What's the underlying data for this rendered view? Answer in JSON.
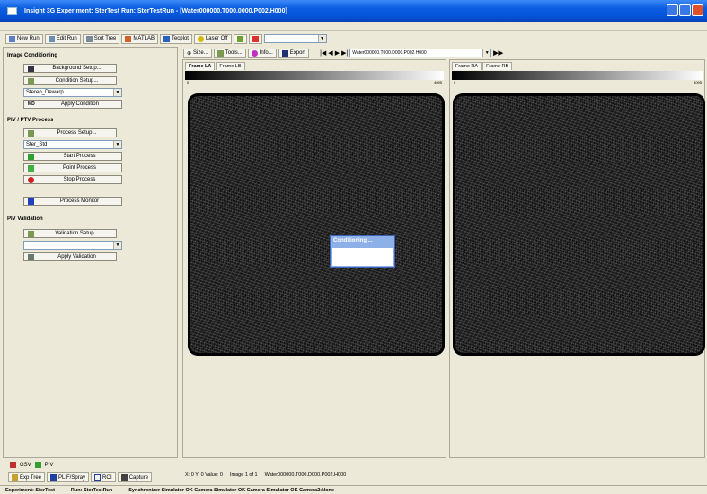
{
  "window": {
    "title": "Insight 3G  Experiment: SterTest    Run: SterTestRun  - [Water000000.T000.0000.P002.H000]"
  },
  "toolbar": [
    {
      "label": "New Run",
      "icon": "new-run-icon",
      "color": "#5a7fc8"
    },
    {
      "label": "Edit Run",
      "icon": "edit-run-icon",
      "color": "#6b8fb0"
    },
    {
      "label": "Sort Tree",
      "icon": "sort-tree-icon",
      "color": "#7a8a9a"
    },
    {
      "label": "MATLAB",
      "icon": "matlab-icon",
      "color": "#d0602a"
    },
    {
      "label": "Tecplot",
      "icon": "tecplot-icon",
      "color": "#2a60c0"
    },
    {
      "label": "Laser Off",
      "icon": "laser-icon",
      "color": "#d4b800"
    }
  ],
  "left": {
    "image_conditioning": {
      "title": "Image Conditioning",
      "background_setup": "Background Setup...",
      "condition_setup": "Condition Setup...",
      "condition_select": "Stereo_Dewarp",
      "apply_condition": "Apply Condition",
      "apply_icon_text": "MD"
    },
    "piv_process": {
      "title": "PIV / PTV Process",
      "process_setup": "Process Setup...",
      "process_select": "Ster_Std",
      "start": "Start Process",
      "point": "Point Process",
      "stop": "Stop Process",
      "monitor": "Process Monitor"
    },
    "validation": {
      "title": "PIV Validation",
      "setup": "Validation Setup...",
      "select": "",
      "apply": "Apply Validation"
    }
  },
  "bottom_tabs": {
    "row1": [
      "GSV",
      "PIV"
    ],
    "row2": [
      "Exp Tree",
      "PLIF/Spray",
      "ROI",
      "Capture"
    ]
  },
  "image_toolbar": {
    "size": "Size...",
    "tools": "Tools...",
    "info": "Info...",
    "export": "Export",
    "nav_first": "|◀",
    "nav_prev": "◀",
    "nav_next": "▶",
    "nav_last": "▶|",
    "file_select": "Water000000.T000.D000.P002.H000",
    "nav_end": "▶▶"
  },
  "frames": {
    "left_tabs": [
      "Frame LA",
      "Frame LB"
    ],
    "right_tabs": [
      "Frame RA",
      "Frame RB"
    ],
    "scale_min": "0",
    "scale_max": "4095"
  },
  "dialog": {
    "title": "Conditioning ..."
  },
  "statusbar": {
    "coords": "X: 0   Y: 0    Value: 0",
    "image": "Image 1 of 1",
    "file": "Water000000.T000.D000.P002.H000",
    "experiment": "Experiment: SterTest",
    "run": "Run: SterTestRun",
    "sync": "Synchronizer Simulator OK   Camera Simulator OK   Camera Simulator OK   Camera2:None"
  }
}
